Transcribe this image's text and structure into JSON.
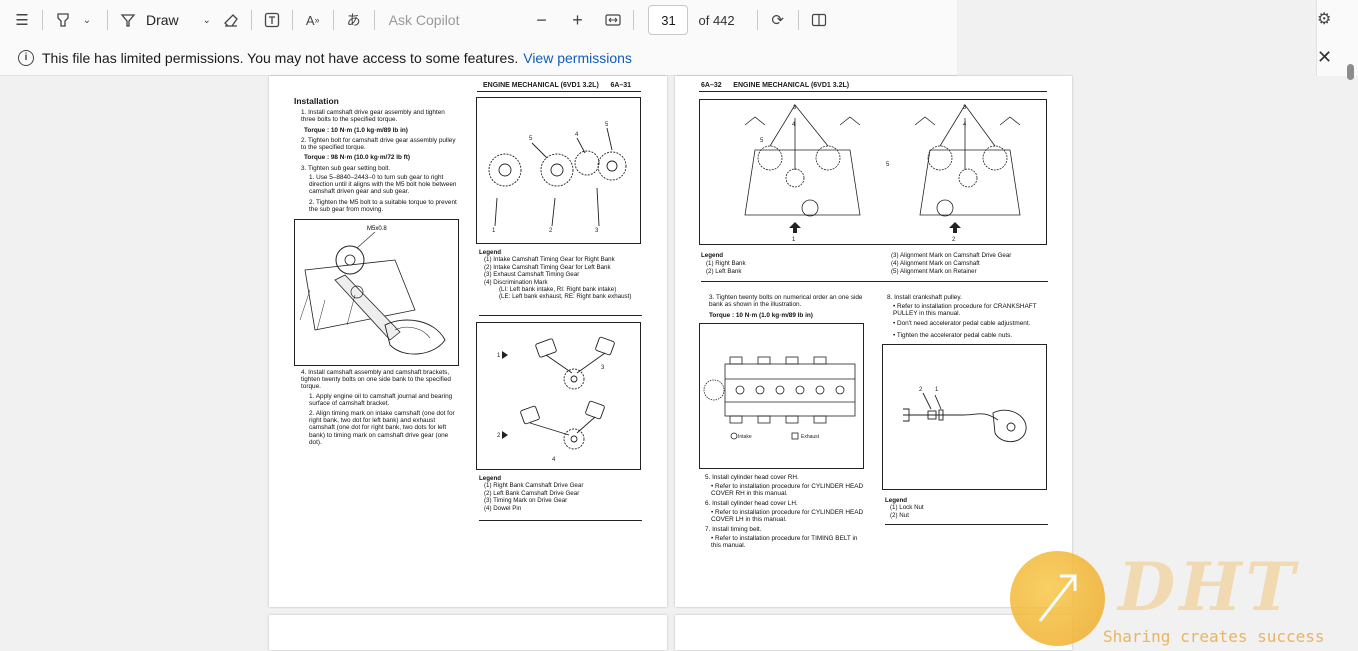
{
  "toolbar": {
    "draw_label": "Draw",
    "ask_copilot_placeholder": "Ask Copilot",
    "zoom_out": "−",
    "zoom_in": "+",
    "current_page": "31",
    "page_count_label": "of 442"
  },
  "infobar": {
    "message": "This file has limited permissions. You may not have access to some features.",
    "link": "View permissions"
  },
  "page31": {
    "header": "ENGINE MECHANICAL (6VD1 3.2L)      6A–31",
    "section_title": "Installation",
    "step1": "1. Install camshaft drive gear assembly and tighten three bolts to the specified torque.",
    "torque1": "Torque : 10 N·m (1.0 kg·m/89 lb in)",
    "step2": "2. Tighten bolt for camshaft drive gear assembly pulley to the specified torque.",
    "torque2": "Torque : 98 N·m (10.0 kg·m/72 lb ft)",
    "step3": "3. Tighten sub gear setting bolt.",
    "step3_1": "1. Use 5–8840–2443–0 to turn sub gear to right direction until it aligns with the M5 bolt hole between camshaft driven gear and sub gear.",
    "step3_2": "2. Tighten the M5 bolt to a suitable torque to prevent the sub gear from moving.",
    "fig_label_m5": "M5x0.8",
    "step4": "4. Install camshaft assembly and camshaft brackets, tighten twenty bolts on one side bank to the specified torque.",
    "step4_1": "1. Apply engine oil to camshaft journal and bearing surface of camshaft bracket.",
    "step4_2": "2. Align timing mark on intake camshaft (one dot for right bank, two dot for left bank) and exhaust camshaft (one dot for right bank, two dots for left bank) to timing mark on camshaft drive gear (one dot).",
    "legend1": {
      "title": "Legend",
      "items": [
        "(1)   Intake Camshaft Timing Gear for Right Bank",
        "(2)   Intake Camshaft Timing Gear for Left Bank",
        "(3)   Exhaust Camshaft Timing Gear",
        "(4)   Discrimination Mark",
        "(LI: Left bank intake, RI: Right bank intake)",
        "(LE: Left bank exhaust, RE: Right bank exhaust)"
      ]
    },
    "legend2": {
      "title": "Legend",
      "items": [
        "(1)   Right Bank Camshaft Drive Gear",
        "(2)   Left Bank Camshaft Drive Gear",
        "(3)   Timing Mark on Drive Gear",
        "(4)   Dowel Pin"
      ]
    }
  },
  "page32": {
    "header": "6A–32      ENGINE MECHANICAL (6VD1 3.2L)",
    "legend_top": {
      "title": "Legend",
      "left": [
        "(1)   Right Bank",
        "(2)   Left Bank"
      ],
      "right": [
        "(3)   Alignment Mark on Camshaft Drive Gear",
        "(4)   Alignment Mark on Camshaft",
        "(5)   Alignment Mark on Retainer"
      ]
    },
    "step3": "3. Tighten twenty bolts on numerical order an one side bank as shown in the illustration.",
    "torque": "Torque : 10 N·m (1.0 kg·m/89 lb in)",
    "fig_intake": "Intake",
    "fig_exhaust": "Exhaust",
    "step5": "5. Install cylinder head cover RH.",
    "step5_b": "• Refer to installation procedure for CYLINDER HEAD COVER RH in this manual.",
    "step6": "6. Install cylinder head cover LH.",
    "step6_b": "• Refer to installation procedure for CYLINDER HEAD COVER LH in this manual.",
    "step7": "7. Install timing belt.",
    "step7_b": "• Refer to installation procedure for TIMING BELT in this manual.",
    "step8": "8. Install crankshaft pulley.",
    "step8_b1": "• Refer to installation procedure for CRANKSHAFT PULLEY in this manual.",
    "step8_b2": "• Don't need accelerator pedal cable adjustment.",
    "step8_b3": "• Tighten the accelerator pedal cable nuts.",
    "legend_nut": {
      "title": "Legend",
      "items": [
        "(1)   Lock Nut",
        "(2)   Nut"
      ]
    }
  },
  "watermark": {
    "brand": "DHT",
    "tagline": "Sharing creates success"
  }
}
